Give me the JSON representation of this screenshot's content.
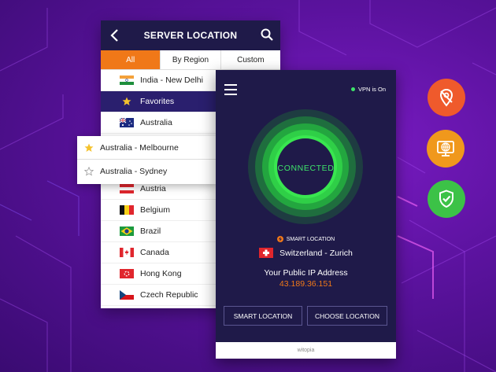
{
  "server_location": {
    "title": "SERVER LOCATION",
    "tabs": [
      {
        "label": "All",
        "active": true
      },
      {
        "label": "By Region",
        "active": false
      },
      {
        "label": "Custom",
        "active": false
      }
    ],
    "rows": [
      {
        "label": "India - New Delhi",
        "flag": "india"
      },
      {
        "label": "Favorites",
        "icon": "star-icon"
      },
      {
        "label": "Australia",
        "flag": "australia"
      },
      {
        "label": "Austria",
        "flag": "austria"
      },
      {
        "label": "Belgium",
        "flag": "belgium"
      },
      {
        "label": "Brazil",
        "flag": "brazil"
      },
      {
        "label": "Canada",
        "flag": "canada"
      },
      {
        "label": "Hong Kong",
        "flag": "hong-kong"
      },
      {
        "label": "Czech Republic",
        "flag": "czech-republic"
      }
    ]
  },
  "popup": {
    "items": [
      {
        "label": "Australia - Melbourne",
        "favorite": true
      },
      {
        "label": "Australia - Sydney",
        "favorite": false
      }
    ]
  },
  "vpn": {
    "status": "VPN is On",
    "connected_label": "CONNECTED",
    "smart_location_tag": "SMART LOCATION",
    "location": "Switzerland - Zurich",
    "ip_label": "Your Public IP Address",
    "ip_value": "43.189.36.151",
    "smart_button": "SMART LOCATION",
    "choose_button": "CHOOSE LOCATION",
    "footer": "witopia"
  },
  "colors": {
    "accent_orange": "#f07818",
    "panel_navy": "#1f1a49",
    "connected_green": "#3ee46a",
    "icon_red": "#ef5a2c",
    "icon_orange": "#f0981c",
    "icon_green": "#3cc247"
  },
  "side_icons": [
    "location-off-icon",
    "globe-monitor-icon",
    "shield-check-icon"
  ]
}
